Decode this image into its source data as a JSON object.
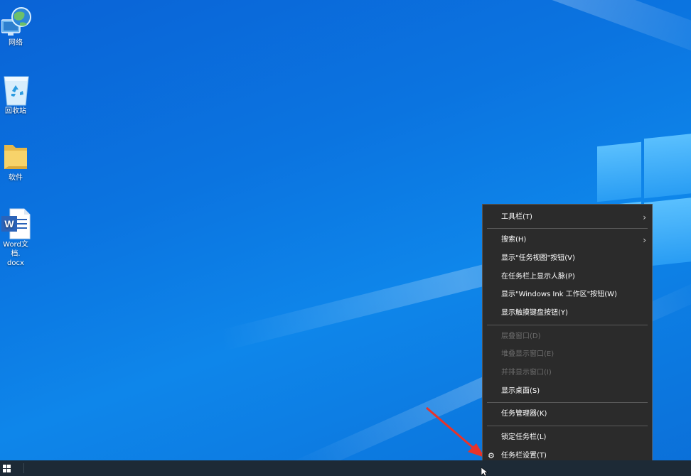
{
  "desktop": {
    "icons": [
      {
        "name": "network",
        "label": "网络"
      },
      {
        "name": "recycle-bin",
        "label": "回收站"
      },
      {
        "name": "folder",
        "label": "软件"
      },
      {
        "name": "word-doc",
        "label_line1": "Word文档.",
        "label_line2": "docx"
      }
    ]
  },
  "context_menu": {
    "items": [
      {
        "id": "toolbars",
        "label": "工具栏(T)",
        "submenu": true,
        "enabled": true
      },
      {
        "id": "search",
        "label": "搜索(H)",
        "submenu": true,
        "enabled": true
      },
      {
        "id": "show-task-view",
        "label": "显示\"任务视图\"按钮(V)",
        "enabled": true
      },
      {
        "id": "show-people",
        "label": "在任务栏上显示人脉(P)",
        "enabled": true
      },
      {
        "id": "show-ink",
        "label": "显示\"Windows Ink 工作区\"按钮(W)",
        "enabled": true
      },
      {
        "id": "show-touch-keyboard",
        "label": "显示触摸键盘按钮(Y)",
        "enabled": true
      },
      {
        "id": "cascade",
        "label": "层叠窗口(D)",
        "enabled": false
      },
      {
        "id": "stacked",
        "label": "堆叠显示窗口(E)",
        "enabled": false
      },
      {
        "id": "side-by-side",
        "label": "并排显示窗口(I)",
        "enabled": false
      },
      {
        "id": "show-desktop",
        "label": "显示桌面(S)",
        "enabled": true
      },
      {
        "id": "task-manager",
        "label": "任务管理器(K)",
        "enabled": true
      },
      {
        "id": "lock-taskbar",
        "label": "锁定任务栏(L)",
        "enabled": true
      },
      {
        "id": "taskbar-settings",
        "label": "任务栏设置(T)",
        "icon": "gear-icon",
        "enabled": true
      }
    ],
    "chevron": "›",
    "gear_glyph": "⚙"
  },
  "colors": {
    "menu_bg": "#2b2b2b",
    "disabled_text": "#6d6d6d",
    "taskbar_bg": "#1d2a36",
    "annotation_arrow": "#e8332a"
  }
}
